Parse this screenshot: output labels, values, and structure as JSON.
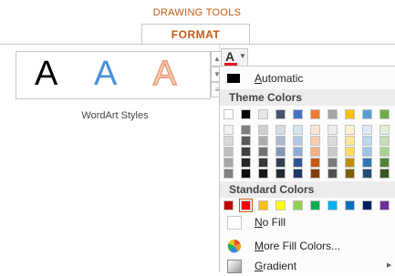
{
  "ribbon": {
    "context_label": "DRAWING TOOLS",
    "tab_label": "FORMAT",
    "group_label": "WordArt Styles",
    "wordart_samples": [
      "A",
      "A",
      "A"
    ],
    "font_color_glyph": "A",
    "font_color_current": "#e81123"
  },
  "menu": {
    "automatic_label": "Automatic",
    "theme_header": "Theme Colors",
    "standard_header": "Standard Colors",
    "no_fill_label": "No Fill",
    "more_colors_label": "More Fill Colors...",
    "gradient_label": "Gradient",
    "theme_columns": [
      [
        "#ffffff",
        "#f2f2f2",
        "#d9d9d9",
        "#bfbfbf",
        "#a6a6a6",
        "#808080"
      ],
      [
        "#000000",
        "#7f7f7f",
        "#595959",
        "#404040",
        "#262626",
        "#0d0d0d"
      ],
      [
        "#e7e6e6",
        "#d0cece",
        "#aeabab",
        "#757171",
        "#3a3838",
        "#161616"
      ],
      [
        "#44546a",
        "#d6dce4",
        "#adb9ca",
        "#8497b0",
        "#333f4f",
        "#222a35"
      ],
      [
        "#4472c4",
        "#d9e2f3",
        "#b4c6e7",
        "#8eaadb",
        "#2f5496",
        "#1f3864"
      ],
      [
        "#ed7d31",
        "#fbe5d6",
        "#f8cbad",
        "#f4b183",
        "#c55a11",
        "#843c0c"
      ],
      [
        "#a5a5a5",
        "#ededed",
        "#dbdbdb",
        "#c9c9c9",
        "#7b7b7b",
        "#525252"
      ],
      [
        "#ffc000",
        "#fff2cc",
        "#ffe699",
        "#ffd966",
        "#bf9000",
        "#7f6000"
      ],
      [
        "#5b9bd5",
        "#deebf7",
        "#bdd7ee",
        "#9dc3e6",
        "#2e75b6",
        "#1f4e79"
      ],
      [
        "#70ad47",
        "#e2f0d9",
        "#c5e0b4",
        "#a9d18e",
        "#548235",
        "#385723"
      ]
    ],
    "standard_colors": [
      "#c00000",
      "#ff0000",
      "#ffc000",
      "#ffff00",
      "#92d050",
      "#00b050",
      "#00b0f0",
      "#0070c0",
      "#002060",
      "#7030a0"
    ],
    "selected_standard_index": 1
  }
}
